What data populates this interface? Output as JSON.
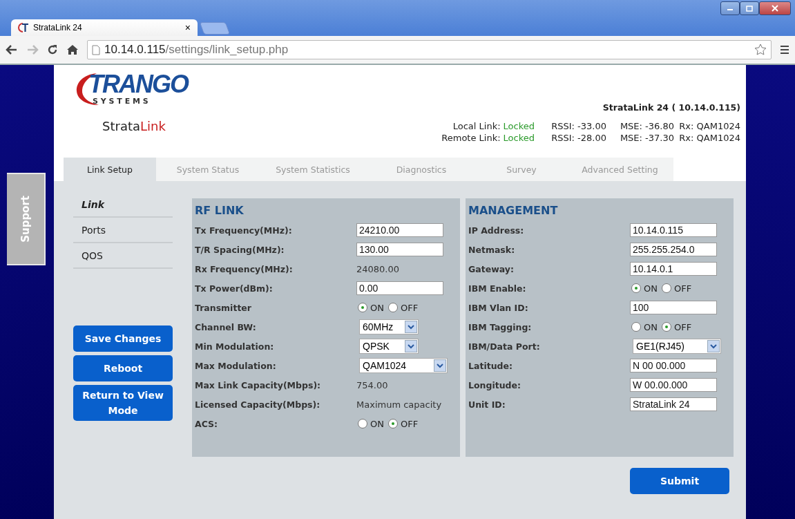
{
  "browser": {
    "tab_title": "StrataLink 24",
    "tab_close": "×",
    "url_host": "10.14.0.115",
    "url_path": "/settings/link_setup.php"
  },
  "logo": {
    "word": "TRANGO",
    "sub": "S Y S T E M S",
    "product_first": "Strata",
    "product_second": "Link"
  },
  "device_title": "StrataLink 24 ( 10.14.0.115)",
  "links": [
    {
      "label": "Local Link:",
      "state": "Locked",
      "rssi": "RSSI: -33.00",
      "mse": "MSE: -36.80",
      "rx": "Rx: QAM1024"
    },
    {
      "label": "Remote Link:",
      "state": "Locked",
      "rssi": "RSSI: -28.00",
      "mse": "MSE: -37.30",
      "rx": "Rx: QAM1024"
    }
  ],
  "tabs": [
    {
      "label": "Link Setup",
      "selected": true
    },
    {
      "label": "System Status",
      "selected": false
    },
    {
      "label": "System Statistics",
      "selected": false
    },
    {
      "label": "Diagnostics",
      "selected": false
    },
    {
      "label": "Survey",
      "selected": false
    },
    {
      "label": "Advanced Setting",
      "selected": false
    }
  ],
  "support_tab": "Support",
  "side_menu": [
    {
      "label": "Link",
      "selected": true
    },
    {
      "label": "Ports",
      "selected": false
    },
    {
      "label": "QOS",
      "selected": false
    }
  ],
  "actions": [
    "Save Changes",
    "Reboot",
    "Return to View Mode"
  ],
  "panels": [
    {
      "title": "RF LINK",
      "rows": [
        {
          "kind": "input",
          "label": "Tx Frequency(MHz):",
          "value": "24210.00"
        },
        {
          "kind": "input",
          "label": "T/R Spacing(MHz):",
          "value": "130.00"
        },
        {
          "kind": "text",
          "label": "Rx Frequency(MHz):",
          "value": "24080.00"
        },
        {
          "kind": "input",
          "label": "Tx Power(dBm):",
          "value": "0.00"
        },
        {
          "kind": "radio",
          "label": "Transmitter",
          "options": [
            {
              "label": "ON",
              "selected": true
            },
            {
              "label": "OFF",
              "selected": false
            }
          ]
        },
        {
          "kind": "select",
          "label": "Channel BW:",
          "value": "60MHz"
        },
        {
          "kind": "select",
          "label": "Min Modulation:",
          "value": "QPSK"
        },
        {
          "kind": "select",
          "label": "Max Modulation:",
          "value": "QAM1024"
        },
        {
          "kind": "text",
          "label": "Max Link Capacity(Mbps):",
          "value": "754.00"
        },
        {
          "kind": "text",
          "label": "Licensed Capacity(Mbps):",
          "value": "Maximum capacity"
        },
        {
          "kind": "radio",
          "label": "ACS:",
          "options": [
            {
              "label": "ON",
              "selected": false
            },
            {
              "label": "OFF",
              "selected": true
            }
          ]
        }
      ]
    },
    {
      "title": "MANAGEMENT",
      "rows": [
        {
          "kind": "input",
          "label": "IP Address:",
          "value": "10.14.0.115"
        },
        {
          "kind": "input",
          "label": "Netmask:",
          "value": "255.255.254.0"
        },
        {
          "kind": "input",
          "label": "Gateway:",
          "value": "10.14.0.1"
        },
        {
          "kind": "radio",
          "label": "IBM Enable:",
          "options": [
            {
              "label": "ON",
              "selected": true
            },
            {
              "label": "OFF",
              "selected": false
            }
          ]
        },
        {
          "kind": "input",
          "label": "IBM Vlan ID:",
          "value": "100"
        },
        {
          "kind": "radio",
          "label": "IBM Tagging:",
          "options": [
            {
              "label": "ON",
              "selected": false
            },
            {
              "label": "OFF",
              "selected": true
            }
          ]
        },
        {
          "kind": "select",
          "label": "IBM/Data Port:",
          "value": "GE1(RJ45)"
        },
        {
          "kind": "input",
          "label": "Latitude:",
          "value": "N 00 00.000"
        },
        {
          "kind": "input",
          "label": "Longitude:",
          "value": "W 00.00.000"
        },
        {
          "kind": "input",
          "label": "Unit ID:",
          "value": "StrataLink 24"
        }
      ]
    }
  ],
  "submit": "Submit"
}
